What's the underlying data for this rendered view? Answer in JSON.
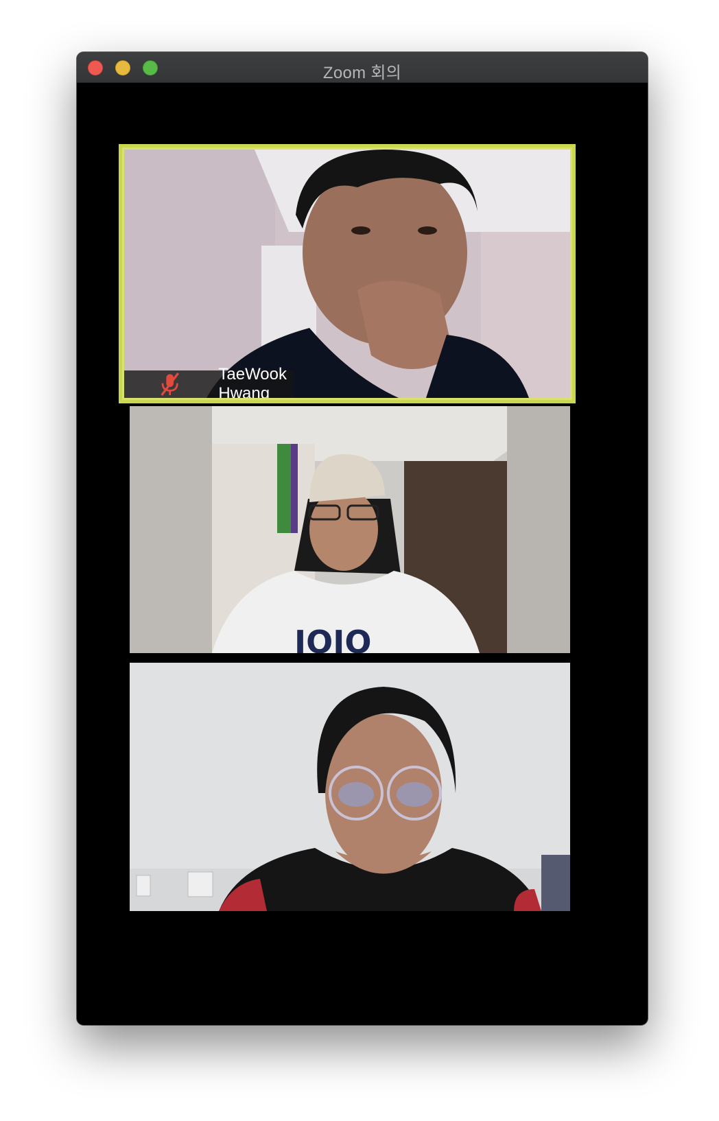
{
  "window": {
    "title": "Zoom 회의"
  },
  "participants": [
    {
      "name": "TaeWook Hwang",
      "muted": true,
      "active_speaker": true
    },
    {
      "name": "",
      "muted": false,
      "active_speaker": false
    },
    {
      "name": "",
      "muted": false,
      "active_speaker": false
    }
  ],
  "colors": {
    "active_border": "#d9e26b",
    "muted_icon": "#e04a3f",
    "background": "#000000"
  },
  "icons": {
    "mute": "microphone-muted-icon"
  }
}
